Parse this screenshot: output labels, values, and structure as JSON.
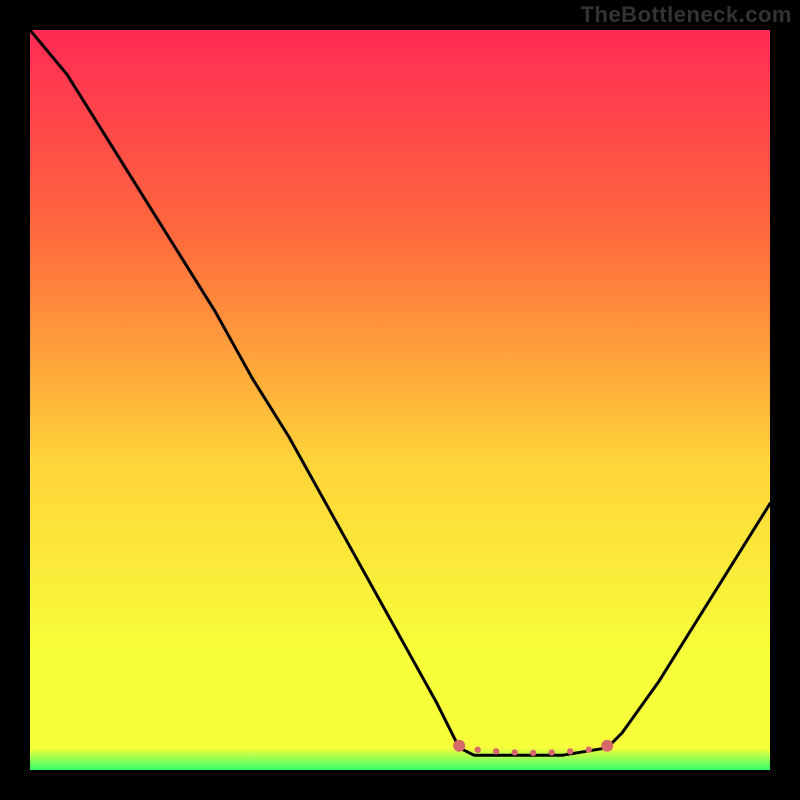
{
  "watermark": "TheBottleneck.com",
  "chart_data": {
    "type": "line",
    "title": "",
    "xlabel": "",
    "ylabel": "",
    "xlim": [
      0,
      1
    ],
    "ylim": [
      0,
      1
    ],
    "background_gradient": {
      "top": "#ff2a55",
      "mid_upper": "#ff6a3d",
      "mid": "#ffd33a",
      "mid_lower": "#f7ff3a",
      "bottom": "#34ff6e"
    },
    "series": [
      {
        "name": "bottleneck-curve",
        "color": "#000000",
        "x": [
          0.0,
          0.05,
          0.1,
          0.15,
          0.2,
          0.25,
          0.3,
          0.35,
          0.4,
          0.45,
          0.5,
          0.55,
          0.58,
          0.6,
          0.65,
          0.72,
          0.78,
          0.8,
          0.85,
          0.9,
          0.95,
          1.0
        ],
        "y_pct": [
          1.0,
          0.94,
          0.86,
          0.78,
          0.7,
          0.62,
          0.53,
          0.45,
          0.36,
          0.27,
          0.18,
          0.09,
          0.03,
          0.02,
          0.02,
          0.02,
          0.03,
          0.05,
          0.12,
          0.2,
          0.28,
          0.36
        ]
      }
    ],
    "annotations": [
      {
        "name": "trough-band",
        "type": "dotted-segment",
        "color": "#d66a6a",
        "x": [
          0.58,
          0.78
        ],
        "y_pct": [
          0.03,
          0.03
        ]
      }
    ]
  }
}
